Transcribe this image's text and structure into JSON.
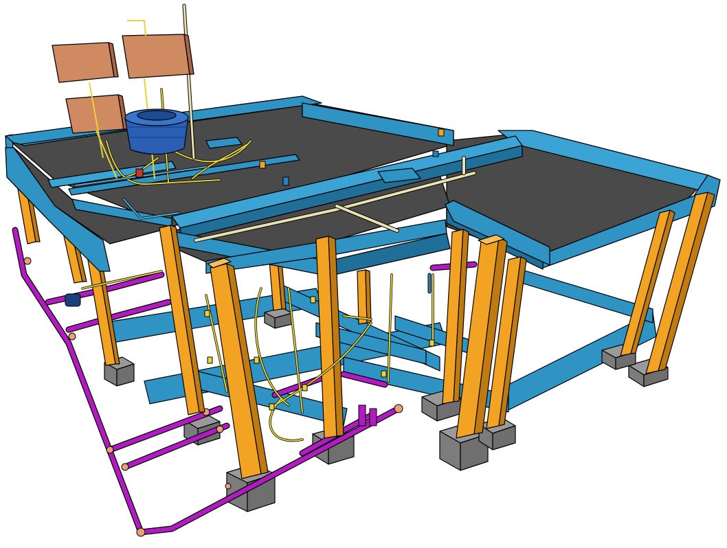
{
  "scene": {
    "subject": "3d-building-structure-with-plumbing",
    "colors": {
      "background": "#ffffff",
      "slab_top": "#4a4a4a",
      "beam": "#2f93c4",
      "beam_dark": "#1f6f99",
      "column": "#f2a324",
      "column_dark": "#c07a12",
      "footing": "#9a9a9a",
      "footing_dark": "#6f6f6f",
      "drain_pipe": "#b01cc0",
      "water_pipe": "#e6d33a",
      "vent_pipe": "#e8e2b0",
      "solar_panel": "#d08a62",
      "water_tank": "#2a5fb5",
      "copper_fitting": "#e6a07a",
      "outline": "#000000"
    },
    "components": [
      "roof-slab",
      "beams",
      "columns",
      "footings",
      "ground-beams",
      "drain-pipes",
      "water-supply-pipes",
      "vent-pipe",
      "solar-panels",
      "water-tank"
    ]
  }
}
